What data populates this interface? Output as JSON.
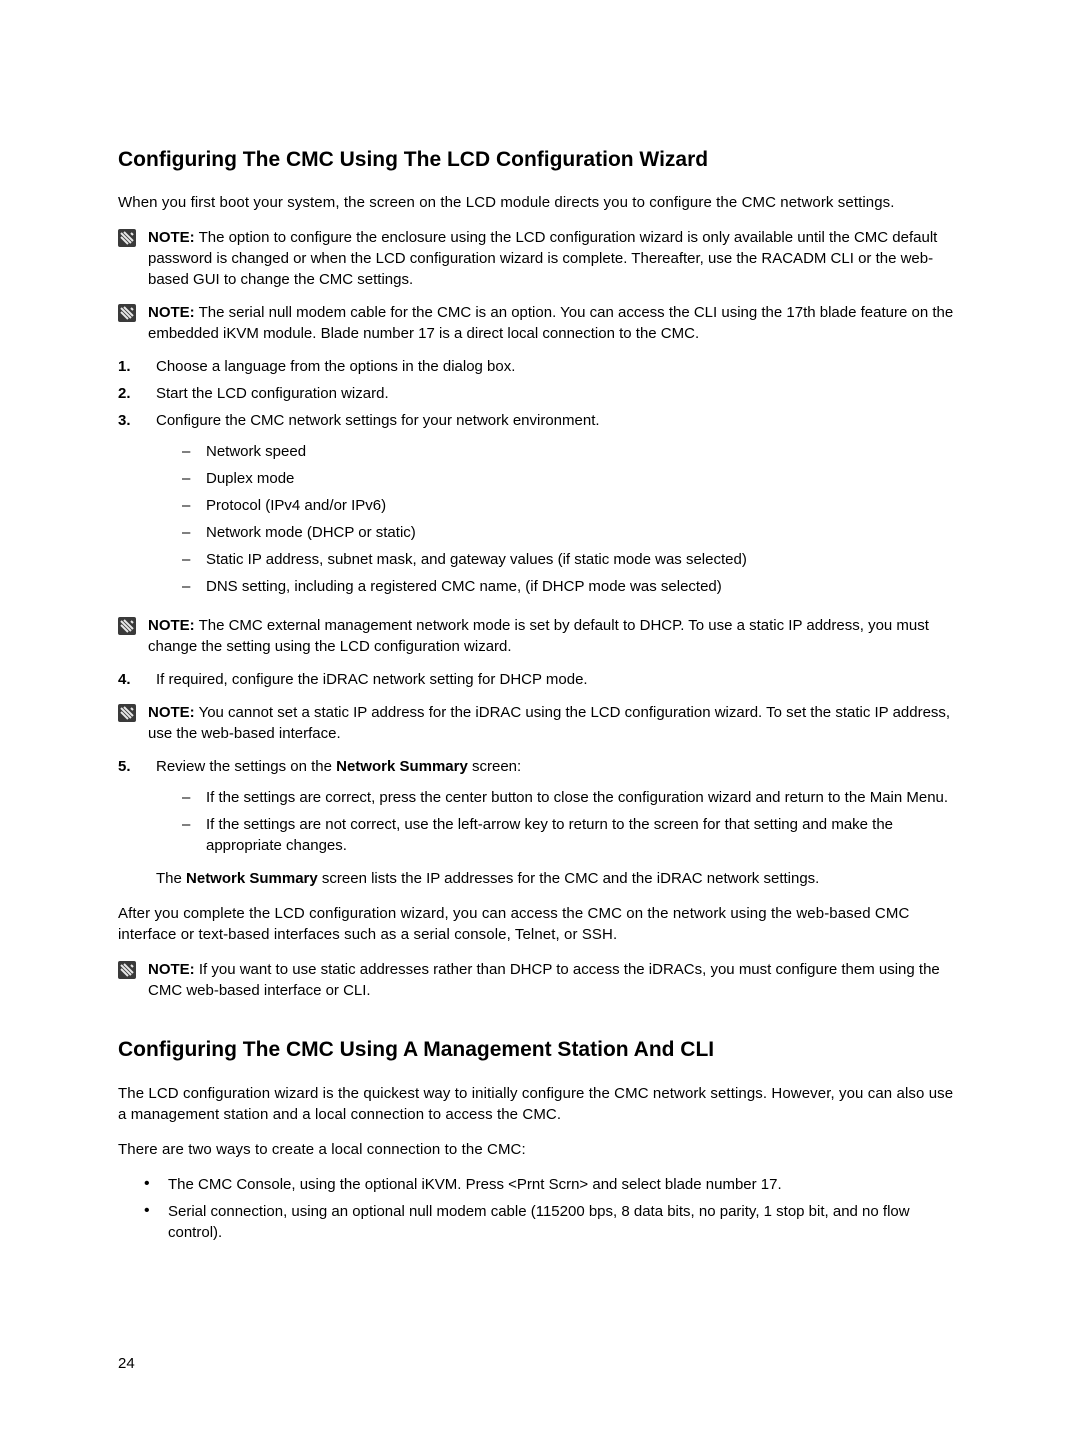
{
  "page_number": "24",
  "section1": {
    "title": "Configuring The CMC Using The LCD Configuration Wizard",
    "intro": "When you first boot your system, the screen on the LCD module directs you to configure the CMC network settings.",
    "note1": "The option to configure the enclosure using the LCD configuration wizard is only available until the CMC default password is changed or when the LCD configuration wizard is complete. Thereafter, use the RACADM CLI or the web-based GUI to change the CMC settings.",
    "note2": "The serial null modem cable for the CMC is an option. You can access the CLI using the 17th blade feature on the embedded iKVM module. Blade number 17 is a direct local connection to the CMC.",
    "step1": "Choose a language from the options in the dialog box.",
    "step2": "Start the LCD configuration wizard.",
    "step3_lead": "Configure the CMC network settings for your network environment.",
    "step3_items": [
      "Network speed",
      "Duplex mode",
      "Protocol (IPv4 and/or IPv6)",
      "Network mode (DHCP or static)",
      "Static IP address, subnet mask, and gateway values (if static mode was selected)",
      "DNS setting, including a registered CMC name, (if DHCP mode was selected)"
    ],
    "note3": "The CMC external management network mode is set by default to DHCP. To use a static IP address, you must change the setting using the LCD configuration wizard.",
    "step4": "If required, configure the iDRAC network setting for DHCP mode.",
    "note4": "You cannot set a static IP address for the iDRAC using the LCD configuration wizard. To set the static IP address, use the web-based interface.",
    "step5_prefix": "Review the settings on the ",
    "step5_bold": "Network Summary",
    "step5_suffix": " screen:",
    "step5_items": [
      "If the settings are correct, press the center button to close the configuration wizard and return to the Main Menu.",
      "If the settings are not correct, use the left-arrow key to return to the screen for that setting and make the appropriate changes."
    ],
    "step5_tail_prefix": "The ",
    "step5_tail_bold": "Network Summary",
    "step5_tail_suffix": " screen lists the IP addresses for the CMC and the iDRAC network settings.",
    "closing": "After you complete the LCD configuration wizard, you can access the CMC on the network using the web-based CMC interface or text-based interfaces such as a serial console, Telnet, or SSH.",
    "note5": "If you want to use static addresses rather than DHCP to access the iDRACs, you must configure them using the CMC web-based interface or CLI."
  },
  "section2": {
    "title": "Configuring The CMC Using A Management Station And CLI",
    "p1": "The LCD configuration wizard is the quickest way to initially configure the CMC network settings. However, you can also use a management station and a local connection to access the CMC.",
    "p2": "There are two ways to create a local connection to the CMC:",
    "bullets": [
      "The CMC Console, using the optional iKVM. Press <Prnt Scrn> and select blade number 17.",
      "Serial connection, using an optional null modem cable (115200 bps, 8 data bits, no parity, 1 stop bit, and no flow control)."
    ]
  },
  "labels": {
    "note": "NOTE:",
    "step1": "1.",
    "step2": "2.",
    "step3": "3.",
    "step4": "4.",
    "step5": "5.",
    "dash": "–",
    "dot": "•"
  }
}
